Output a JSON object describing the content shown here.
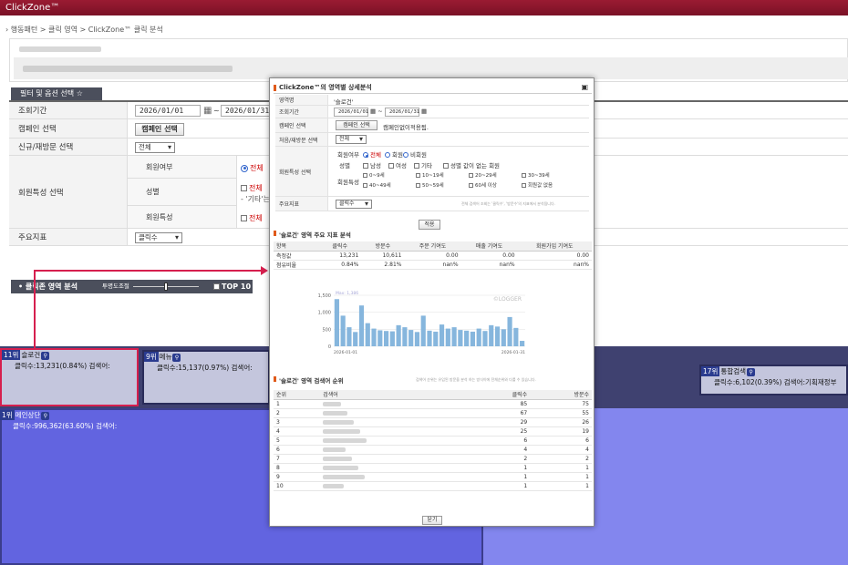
{
  "app": {
    "title": "ClickZone™"
  },
  "breadcrumb": "› 행동패턴 > 클릭 영역 > ClickZone™ 클릭 분석",
  "filter": {
    "header": "필터 및 옵션 선택 ☆",
    "period_label": "조회기간",
    "date_from": "2026/01/01",
    "date_to": "2026/01/31",
    "campaign_label": "캠페인 선택",
    "campaign_button": "캠페인 선택",
    "visitor_label": "신규/재방문 선택",
    "visitor_value": "전체",
    "member_label": "회원특성 선택",
    "member_sub1": "회원여부",
    "member_sub1_value": "전체",
    "member_sub2": "성별",
    "member_sub2_value": "전체",
    "member_sub2_note": "- '기타'는",
    "member_sub3": "회원특성",
    "member_sub3_value": "전체",
    "kpi_label": "주요지표",
    "kpi_value": "클릭수"
  },
  "clickbar": {
    "title": "• 클릭존 영역 분석",
    "slider_label": "투명도조절",
    "top10": "TOP 10"
  },
  "zones": [
    {
      "rank": "11위",
      "name": "슬로건",
      "info": "클릭수:13,231(0.84%) 검색어:"
    },
    {
      "rank": "9위",
      "name": "메뉴",
      "info": "클릭수:15,137(0.97%) 검색어:"
    },
    {
      "rank": "17위",
      "name": "통합검색",
      "info": "클릭수:6,102(0.39%) 검색어:기획재정부"
    },
    {
      "rank": "1위",
      "name": "메인상단",
      "info": "클릭수:996,362(63.60%) 검색어:"
    }
  ],
  "modal": {
    "title": "ClickZone™의 영역별 상세분석",
    "area_label": "영역명",
    "area_value": "'슬로건'",
    "period_label": "조회기간",
    "date_from": "2026/01/01",
    "date_to": "2026/01/31",
    "campaign_label": "캠페인 선택",
    "campaign_button": "캠페인 선택",
    "campaign_note": "캠페인없이적용됨.",
    "visitor_label": "처음/재방문 선택",
    "visitor_value": "전체",
    "member_label": "회원특성 선택",
    "member_row1_label": "회원여부",
    "member_row1_opts": [
      "전체",
      "회원",
      "비회원"
    ],
    "member_row2_label": "성별",
    "member_row2_opts": [
      "남성",
      "여성",
      "기타",
      "성별 값이 없는 회원"
    ],
    "member_row3_label": "회원특성",
    "ages": [
      "0~9세",
      "10~19세",
      "20~29세",
      "30~39세",
      "40~49세",
      "50~59세",
      "60세 이상",
      "회원값 없음"
    ],
    "kpi_label": "주요지표",
    "kpi_value": "클릭수",
    "kpi_note": "전체 검색어 조회는 '클릭수', '방문수'의 지표에서 분석됩니다.",
    "apply_button": "적용",
    "section1_title": "'슬로건' 영역 주요 지표 분석",
    "kpi_table": {
      "headers": [
        "항목",
        "클릭수",
        "방문수",
        "주문 기여도",
        "매출 기여도",
        "회원가입 기여도"
      ],
      "rows": [
        [
          "측정값",
          "13,231",
          "10,611",
          "0.00",
          "0.00",
          "0.00"
        ],
        [
          "점유비율",
          "0.84%",
          "2.81%",
          "nan%",
          "nan%",
          "nan%"
        ]
      ]
    },
    "section2_title": "'슬로건' 영역 검색어 순위",
    "section2_note": "검색어 순위는 유입된 방문을 분석 하는 방식이에 전체순위와 다를 수 있습니다.",
    "search_table": {
      "headers": [
        "순위",
        "검색어",
        "클릭수",
        "방문수"
      ],
      "rows": [
        [
          "1",
          "",
          "85",
          "75"
        ],
        [
          "2",
          "",
          "67",
          "55"
        ],
        [
          "3",
          "",
          "29",
          "26"
        ],
        [
          "4",
          "",
          "25",
          "19"
        ],
        [
          "5",
          "",
          "6",
          "6"
        ],
        [
          "6",
          "",
          "4",
          "4"
        ],
        [
          "7",
          "",
          "2",
          "2"
        ],
        [
          "8",
          "",
          "1",
          "1"
        ],
        [
          "9",
          "",
          "1",
          "1"
        ],
        [
          "10",
          "",
          "1",
          "1"
        ]
      ]
    },
    "close_button": "닫기"
  },
  "chart_data": {
    "type": "bar",
    "watermark": "©LOGGER",
    "max_label": "Max: 1,386",
    "x_start_label": "2026-01-01",
    "x_end_label": "2026-01-31",
    "yticks": [
      "1,500",
      "1,000",
      "500",
      "0"
    ],
    "ylim": [
      0,
      1500
    ],
    "values": [
      1386,
      900,
      560,
      420,
      1200,
      680,
      520,
      470,
      450,
      440,
      620,
      560,
      480,
      420,
      900,
      460,
      430,
      640,
      520,
      560,
      480,
      460,
      430,
      520,
      450,
      620,
      580,
      500,
      860,
      540,
      160
    ]
  }
}
